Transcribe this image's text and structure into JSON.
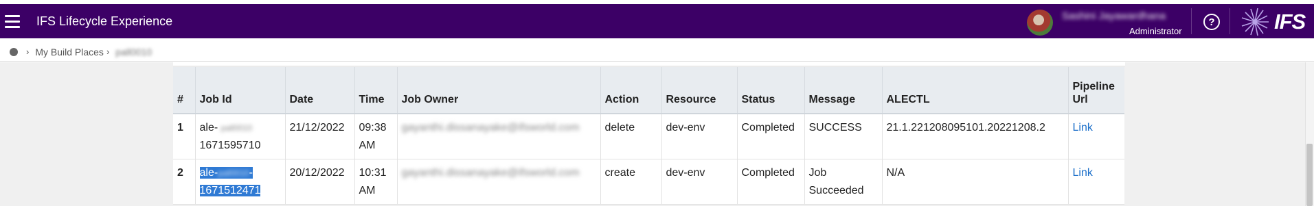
{
  "header": {
    "title": "IFS Lifecycle Experience",
    "user_name": "Sashini Jayawardhana",
    "user_role": "Administrator",
    "help_glyph": "?",
    "logo_text": "IFS",
    "colors": {
      "bar": "#3c0066"
    }
  },
  "breadcrumb": {
    "items": [
      "My Build Places",
      "pall0010"
    ]
  },
  "table": {
    "headers": [
      "#",
      "Job Id",
      "Date",
      "Time",
      "Job Owner",
      "Action",
      "Resource",
      "Status",
      "Message",
      "ALECTL",
      "Pipeline Url"
    ],
    "rows": [
      {
        "num": "1",
        "job_id_prefix": "ale-",
        "job_id_mid": "pall0010",
        "job_id_suffix": "1671595710",
        "date": "21/12/2022",
        "time_1": "09:38",
        "time_2": "AM",
        "owner": "gayanthi.dissanayake@ifsworld.com",
        "action": "delete",
        "resource": "dev-env",
        "status": "Completed",
        "message": "SUCCESS",
        "alectl": "21.1.221208095101.20221208.2",
        "url": "Link"
      },
      {
        "num": "2",
        "job_id_prefix": "ale-",
        "job_id_mid": "pall0010",
        "job_id_dash": "-",
        "job_id_suffix": "1671512471",
        "date": "20/12/2022",
        "time_1": "10:31",
        "time_2": "AM",
        "owner": "gayanthi.dissanayake@ifsworld.com",
        "action": "create",
        "resource": "dev-env",
        "status": "Completed",
        "message_1": "Job",
        "message_2": "Succeeded",
        "alectl": "N/A",
        "url": "Link"
      }
    ]
  }
}
